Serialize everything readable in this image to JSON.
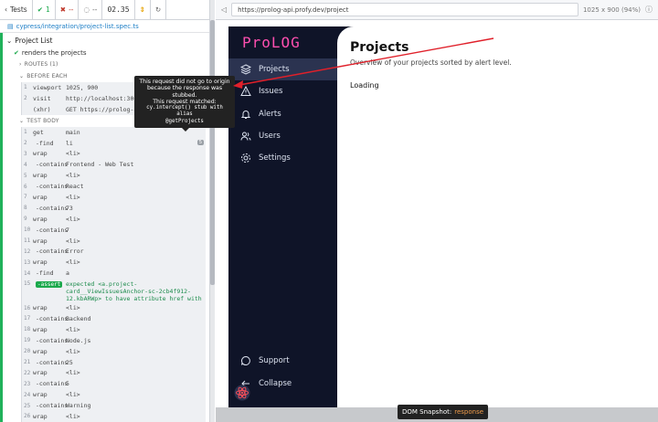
{
  "reporter": {
    "tests_label": "Tests",
    "passed": "1",
    "failed": "--",
    "pending": "--",
    "duration": "02.35",
    "spec_path": "cypress/integration/project-list.spec.ts",
    "suite_title": "Project List",
    "test_title": "renders the projects",
    "routes_label": "ROUTES (1)",
    "before_each_label": "BEFORE EACH",
    "test_body_label": "TEST BODY",
    "before_cmds": [
      {
        "num": "1",
        "name": "viewport",
        "msg": "1025, 900"
      },
      {
        "num": "2",
        "name": "visit",
        "msg": "http://localhost:3000"
      },
      {
        "num": "",
        "name": "(xhr)",
        "msg": "GET https://prolog-api.pro…",
        "alias": "getProjects"
      }
    ],
    "body_cmds": [
      {
        "num": "1",
        "name": "get",
        "msg": "main"
      },
      {
        "num": "2",
        "name": "-find",
        "msg": "li",
        "count": "5"
      },
      {
        "num": "3",
        "name": "wrap",
        "msg": "<li>"
      },
      {
        "num": "4",
        "name": "-contains",
        "msg": "Frontend - Web Test"
      },
      {
        "num": "5",
        "name": "wrap",
        "msg": "<li>"
      },
      {
        "num": "6",
        "name": "-contains",
        "msg": "React"
      },
      {
        "num": "7",
        "name": "wrap",
        "msg": "<li>"
      },
      {
        "num": "8",
        "name": "-contains",
        "msg": "73"
      },
      {
        "num": "9",
        "name": "wrap",
        "msg": "<li>"
      },
      {
        "num": "10",
        "name": "-contains",
        "msg": "7"
      },
      {
        "num": "11",
        "name": "wrap",
        "msg": "<li>"
      },
      {
        "num": "12",
        "name": "-contains",
        "msg": "Error"
      },
      {
        "num": "13",
        "name": "wrap",
        "msg": "<li>"
      },
      {
        "num": "14",
        "name": "-find",
        "msg": "a"
      },
      {
        "num": "15",
        "name": "-assert",
        "msg": "expected <a.project-card__ViewIssuesAnchor-sc-2cb4f912-12.kbARWp> to have attribute href with the value /issues",
        "assert": true
      },
      {
        "num": "16",
        "name": "wrap",
        "msg": "<li>"
      },
      {
        "num": "17",
        "name": "-contains",
        "msg": "Backend"
      },
      {
        "num": "18",
        "name": "wrap",
        "msg": "<li>"
      },
      {
        "num": "19",
        "name": "-contains",
        "msg": "Node.js"
      },
      {
        "num": "20",
        "name": "wrap",
        "msg": "<li>"
      },
      {
        "num": "21",
        "name": "-contains",
        "msg": "25"
      },
      {
        "num": "22",
        "name": "wrap",
        "msg": "<li>"
      },
      {
        "num": "23",
        "name": "-contains",
        "msg": "5"
      },
      {
        "num": "24",
        "name": "wrap",
        "msg": "<li>"
      },
      {
        "num": "25",
        "name": "-contains",
        "msg": "Warning"
      },
      {
        "num": "26",
        "name": "wrap",
        "msg": "<li>"
      }
    ]
  },
  "browser": {
    "url": "https://prolog-api.profy.dev/project",
    "viewport": "1025 x 900",
    "zoom": "(94%)"
  },
  "app": {
    "logo": "ProLOG",
    "nav": [
      {
        "label": "Projects",
        "icon": "layers-icon"
      },
      {
        "label": "Issues",
        "icon": "warning-icon"
      },
      {
        "label": "Alerts",
        "icon": "bell-icon"
      },
      {
        "label": "Users",
        "icon": "users-icon"
      },
      {
        "label": "Settings",
        "icon": "gear-icon"
      }
    ],
    "support_label": "Support",
    "collapse_label": "Collapse",
    "page_title": "Projects",
    "page_subtitle": "Overview of your projects sorted by alert level.",
    "loading_text": "Loading"
  },
  "tooltip": {
    "line1": "This request did not go to origin because the response was stubbed.",
    "line2": "This request matched:",
    "line3": "cy.intercept() stub with alias",
    "line4": "@getProjects"
  },
  "snapshot": {
    "label": "DOM Snapshot:",
    "state": "response"
  },
  "colors": {
    "pass": "#1ba94c",
    "accent_pink": "#ff4fb0",
    "sidebar_bg": "#0f1428",
    "active_bg": "#2b3350",
    "arrow": "#e0202a"
  }
}
